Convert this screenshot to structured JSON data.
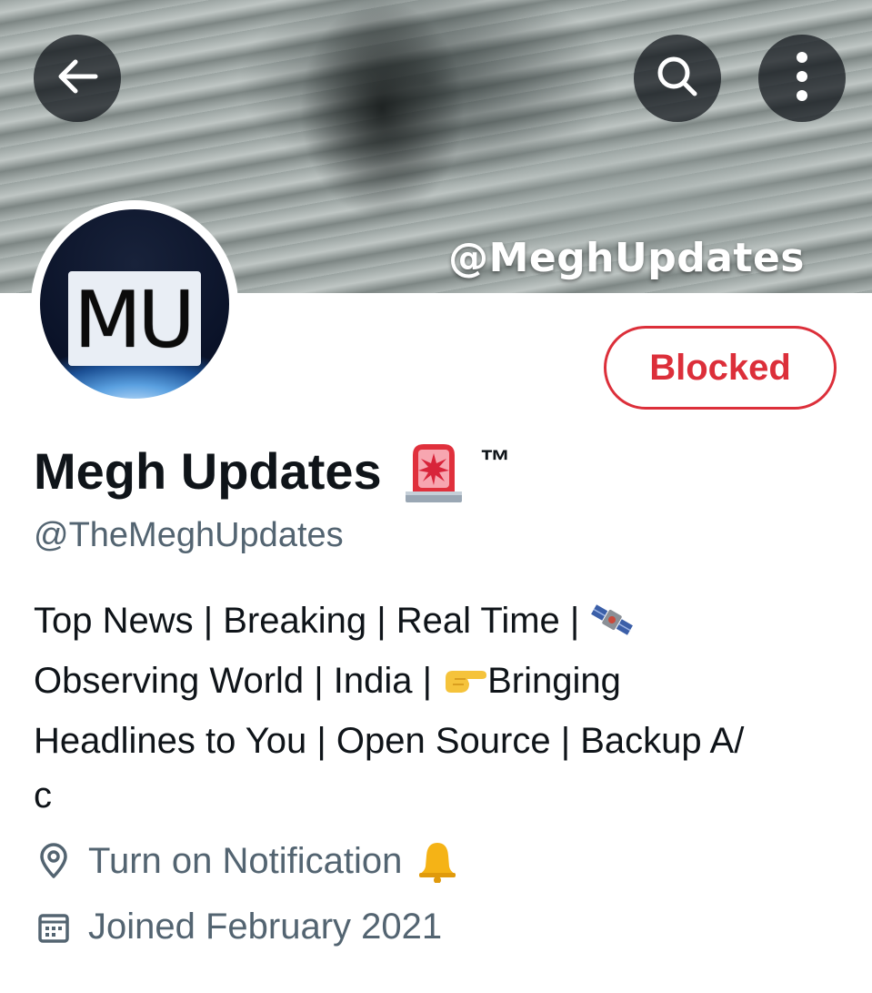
{
  "header": {
    "watermark": "@MeghUpdates",
    "back_icon": "arrow-left-icon",
    "search_icon": "search-icon",
    "more_icon": "more-vertical-icon"
  },
  "profile": {
    "avatar_text": "MU",
    "blocked_label": "Blocked",
    "display_name": "Megh Updates",
    "name_emoji": "police-siren-emoji",
    "trademark": "™",
    "handle": "@TheMeghUpdates",
    "bio": {
      "line1": "Top News | Breaking | Real Time | ",
      "line2_start": "Observing World | India | ",
      "line2_end": "Bringing",
      "line3": "Headlines to You | Open Source |  Backup A/",
      "line4": "c"
    },
    "location": "Turn on Notification",
    "joined": "Joined February 2021"
  },
  "colors": {
    "blocked_red": "#dc2f3a",
    "text_primary": "#0f1419",
    "text_secondary": "#536471"
  }
}
